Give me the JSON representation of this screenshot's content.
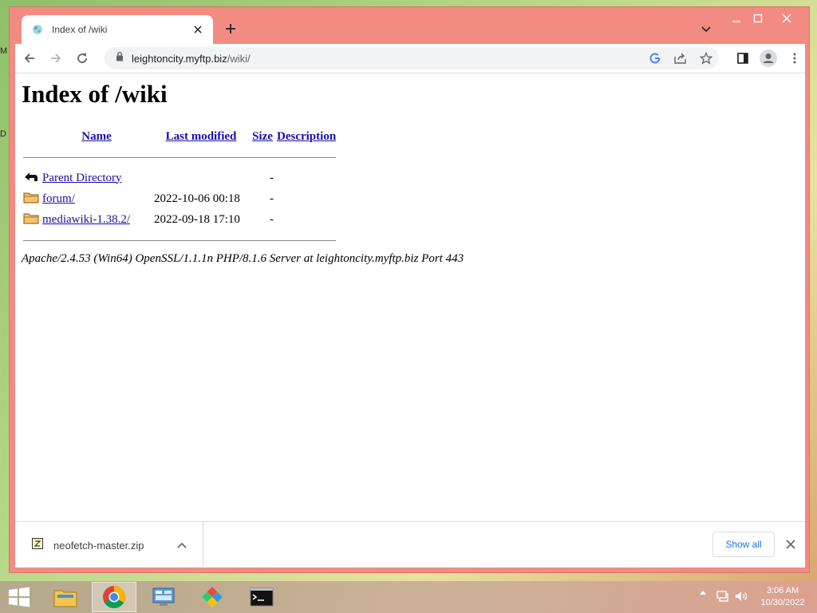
{
  "desktop": {
    "label_top": "M",
    "label_mid": "D"
  },
  "browser": {
    "tab": {
      "title": "Index of /wiki"
    },
    "url": {
      "host": "leightoncity.myftp.biz",
      "path": "/wiki/"
    }
  },
  "page": {
    "heading": "Index of /wiki",
    "columns": [
      "Name",
      "Last modified",
      "Size",
      "Description"
    ],
    "rows": [
      {
        "icon": "parent-directory-icon",
        "name": "Parent Directory",
        "modified": "",
        "size": "-"
      },
      {
        "icon": "folder-icon",
        "name": "forum/",
        "modified": "2022-10-06 00:18",
        "size": "-"
      },
      {
        "icon": "folder-icon",
        "name": "mediawiki-1.38.2/",
        "modified": "2022-09-18 17:10",
        "size": "-"
      }
    ],
    "address": "Apache/2.4.53 (Win64) OpenSSL/1.1.1n PHP/8.1.6 Server at leightoncity.myftp.biz Port 443"
  },
  "downloads": {
    "file_name": "neofetch-master.zip",
    "show_all": "Show all"
  },
  "taskbar": {
    "apps": [
      "file-explorer-icon",
      "chrome-icon",
      "control-panel-icon",
      "paint-icon",
      "command-prompt-icon"
    ],
    "time": "3:06 AM",
    "date": "10/30/2022"
  },
  "colors": {
    "window_frame": "#f28b82",
    "link": "#1a0dab",
    "accent": "#1a73e8"
  }
}
